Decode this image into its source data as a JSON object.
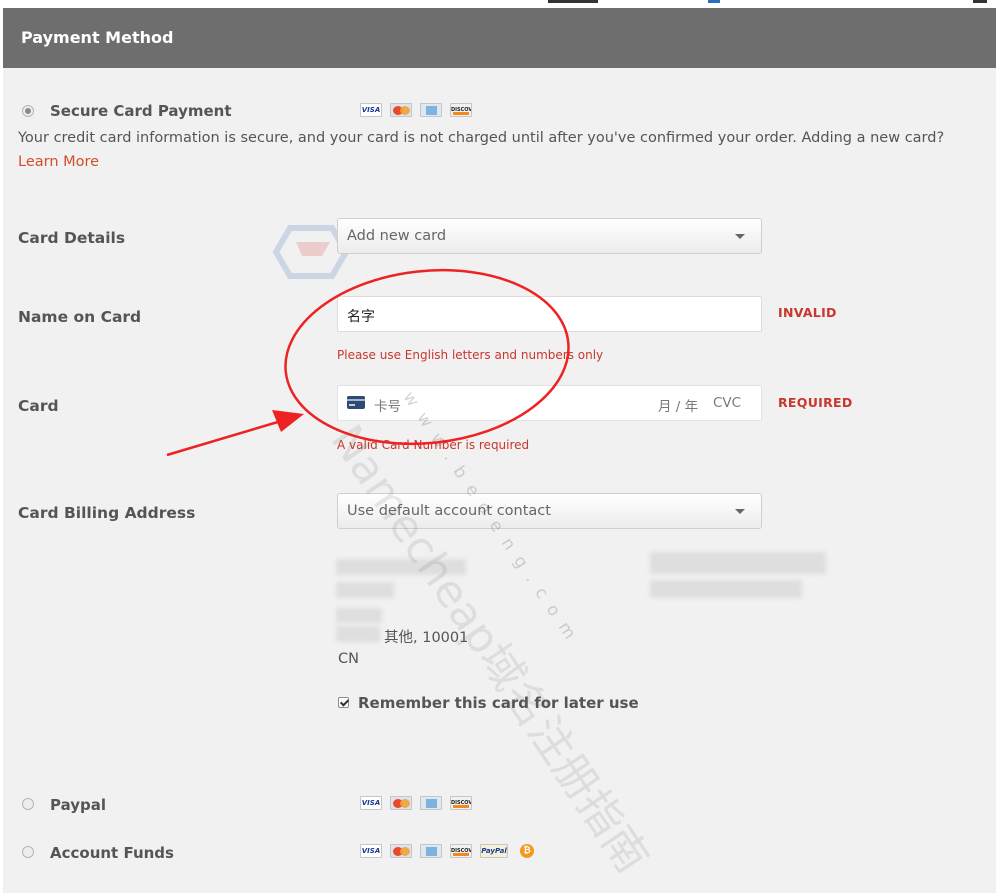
{
  "header": {
    "title": "Payment Method"
  },
  "options": {
    "secure_card": {
      "label": "Secure Card Payment",
      "selected": true
    },
    "paypal": {
      "label": "Paypal",
      "selected": false
    },
    "account_funds": {
      "label": "Account Funds",
      "selected": false
    }
  },
  "card_logos": {
    "visa": "VISA",
    "discover": "DISCOVER",
    "paypal": "PayPal",
    "bitcoin": "₿"
  },
  "info": {
    "text": "Your credit card information is secure, and your card is not charged until after you've confirmed your order. Adding a new card?",
    "learn_more": "Learn More"
  },
  "form": {
    "card_details": {
      "label": "Card Details",
      "value": "Add new card"
    },
    "name_on_card": {
      "label": "Name on Card",
      "value": "名字",
      "status": "INVALID",
      "error": "Please use English letters and numbers only"
    },
    "card": {
      "label": "Card",
      "number_placeholder": "卡号",
      "expiry_placeholder": "月 / 年",
      "cvc_placeholder": "CVC",
      "status": "REQUIRED",
      "error": "A valid Card Number is required"
    },
    "billing": {
      "label": "Card Billing Address",
      "value": "Use default account contact",
      "city_line": "其他, 10001",
      "country": "CN"
    },
    "remember": {
      "label": "Remember this card for later use",
      "checked": true
    }
  },
  "watermark": {
    "text": "Namecheap域名注册指南",
    "sub": "www.bedeng.com"
  },
  "colors": {
    "header_bg": "#6e6e6e",
    "panel_bg": "#f1f1f1",
    "error": "#c8372d",
    "link": "#d24e2c",
    "annotation": "#ee2222"
  }
}
